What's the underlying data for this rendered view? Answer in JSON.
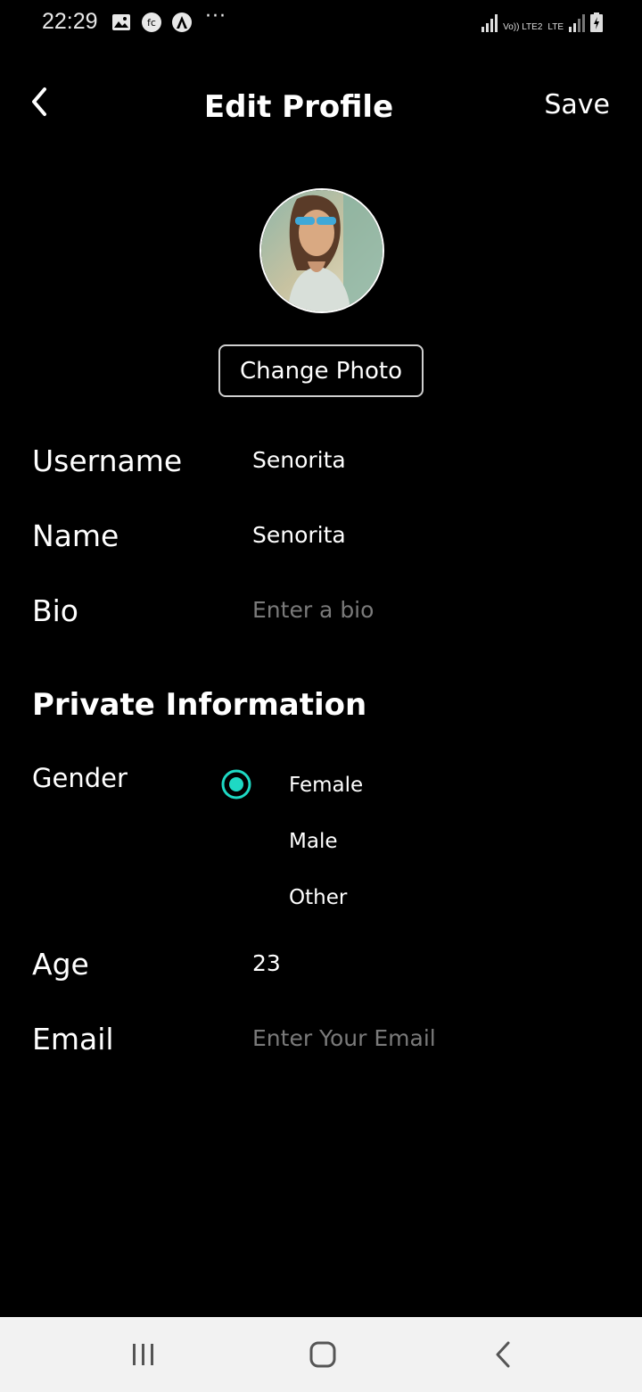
{
  "status": {
    "time": "22:29",
    "more": "···",
    "net1": "Vo)) LTE2",
    "net2": "LTE"
  },
  "header": {
    "title": "Edit Profile",
    "save_label": "Save"
  },
  "profile": {
    "change_photo_label": "Change Photo"
  },
  "fields": {
    "username": {
      "label": "Username",
      "value": "Senorita"
    },
    "name": {
      "label": "Name",
      "value": "Senorita"
    },
    "bio": {
      "label": "Bio",
      "placeholder": "Enter a bio"
    }
  },
  "private": {
    "title": "Private Information",
    "gender": {
      "label": "Gender",
      "options": [
        "Female",
        "Male",
        "Other"
      ],
      "selected": "Female"
    },
    "age": {
      "label": "Age",
      "value": "23"
    },
    "email": {
      "label": "Email",
      "placeholder": "Enter Your Email"
    }
  },
  "colors": {
    "accent": "#1ed9c4",
    "background": "#000000",
    "navbar": "#f2f2f2"
  },
  "icons": {
    "back": "chevron-left-icon",
    "nav_recents": "recents-icon",
    "nav_home": "home-icon",
    "nav_back": "back-icon"
  }
}
